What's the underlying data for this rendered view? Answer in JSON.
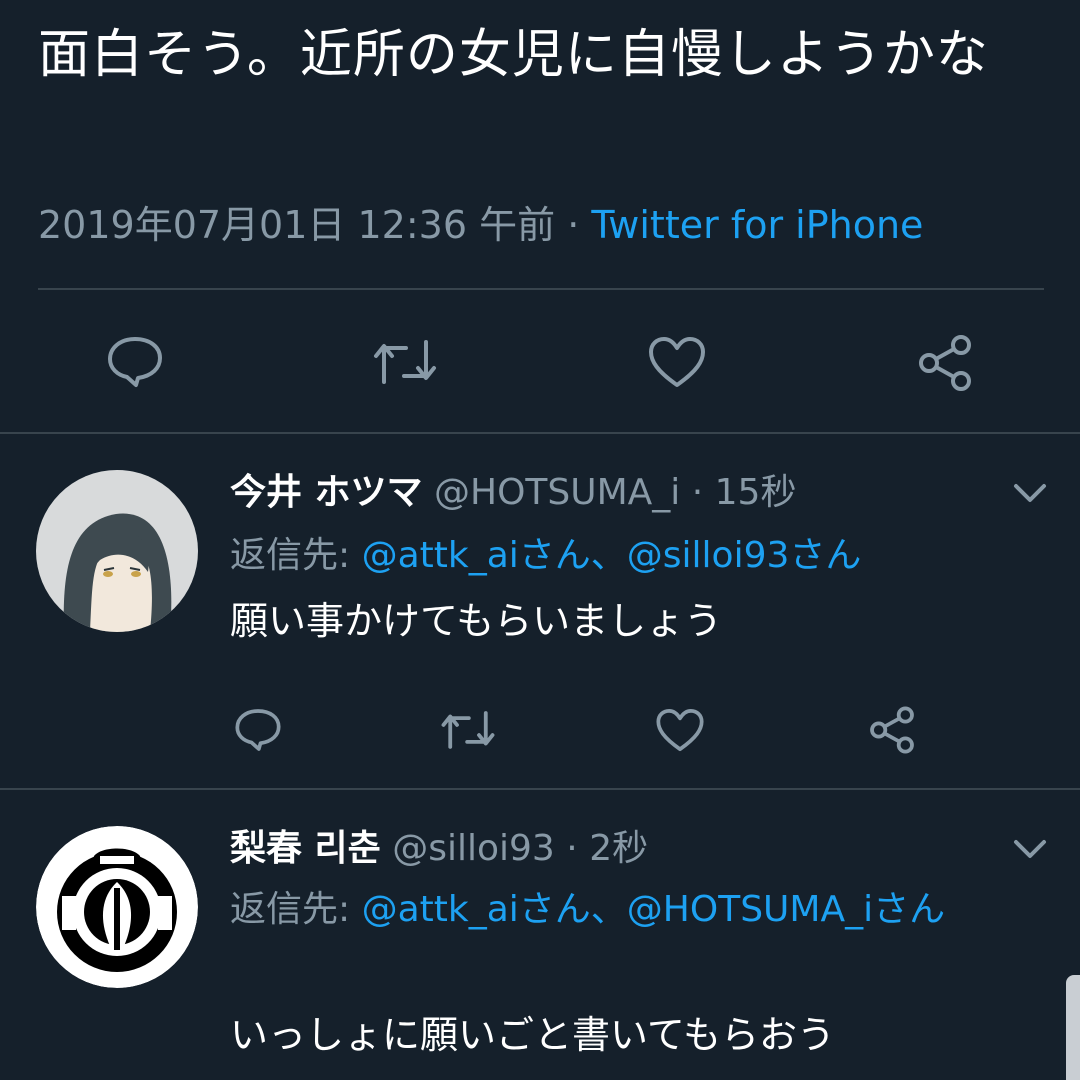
{
  "main_tweet": {
    "text": "面白そう。近所の女児に自慢しようかな",
    "timestamp": "2019年07月01日 12:36 午前",
    "separator": "·",
    "source": "Twitter for iPhone",
    "actions": [
      "reply-icon",
      "retweet-icon",
      "like-icon",
      "share-icon"
    ]
  },
  "replies": [
    {
      "display_name": "今井 ホツマ",
      "handle": "@HOTSUMA_i",
      "separator": "·",
      "time": "15秒",
      "reply_to_label": "返信先:",
      "reply_to_mentions": "@attk_aiさん、@silloi93さん",
      "text": "願い事かけてもらいましょう",
      "actions": [
        "reply-icon",
        "retweet-icon",
        "like-icon",
        "share-icon"
      ]
    },
    {
      "display_name": "梨春 리춘",
      "handle": "@silloi93",
      "separator": "·",
      "time": "2秒",
      "reply_to_label": "返信先:",
      "reply_to_mentions": "@attk_aiさん、@HOTSUMA_iさん",
      "text": "いっしょに願いごと書いてもらおう",
      "actions": [
        "reply-icon",
        "retweet-icon",
        "like-icon",
        "share-icon"
      ]
    }
  ],
  "colors": {
    "background": "#15202b",
    "text": "#ffffff",
    "secondary": "#8899a6",
    "accent": "#1da1f2",
    "divider": "#38444d"
  }
}
